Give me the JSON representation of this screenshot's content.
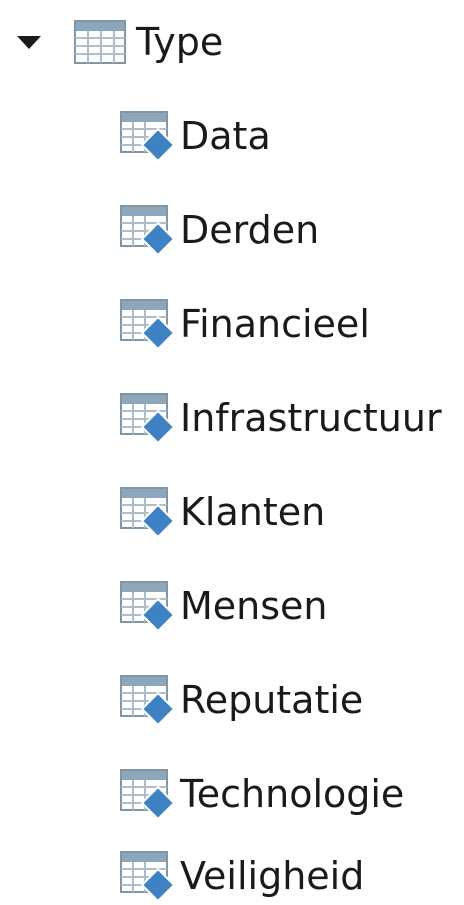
{
  "tree": {
    "root": {
      "label": "Type",
      "expanded": true,
      "icon": "table-icon"
    },
    "children": [
      {
        "label": "Data",
        "icon": "table-key-icon"
      },
      {
        "label": "Derden",
        "icon": "table-key-icon"
      },
      {
        "label": "Financieel",
        "icon": "table-key-icon"
      },
      {
        "label": "Infrastructuur",
        "icon": "table-key-icon"
      },
      {
        "label": "Klanten",
        "icon": "table-key-icon"
      },
      {
        "label": "Mensen",
        "icon": "table-key-icon"
      },
      {
        "label": "Reputatie",
        "icon": "table-key-icon"
      },
      {
        "label": "Technologie",
        "icon": "table-key-icon"
      },
      {
        "label": "Veiligheid",
        "icon": "table-key-icon"
      }
    ]
  },
  "colors": {
    "text": "#1a1a1a",
    "icon_border": "#7f95a8",
    "icon_header": "#8ea6ba",
    "icon_cell": "#ffffff",
    "diamond": "#3e82c4"
  }
}
